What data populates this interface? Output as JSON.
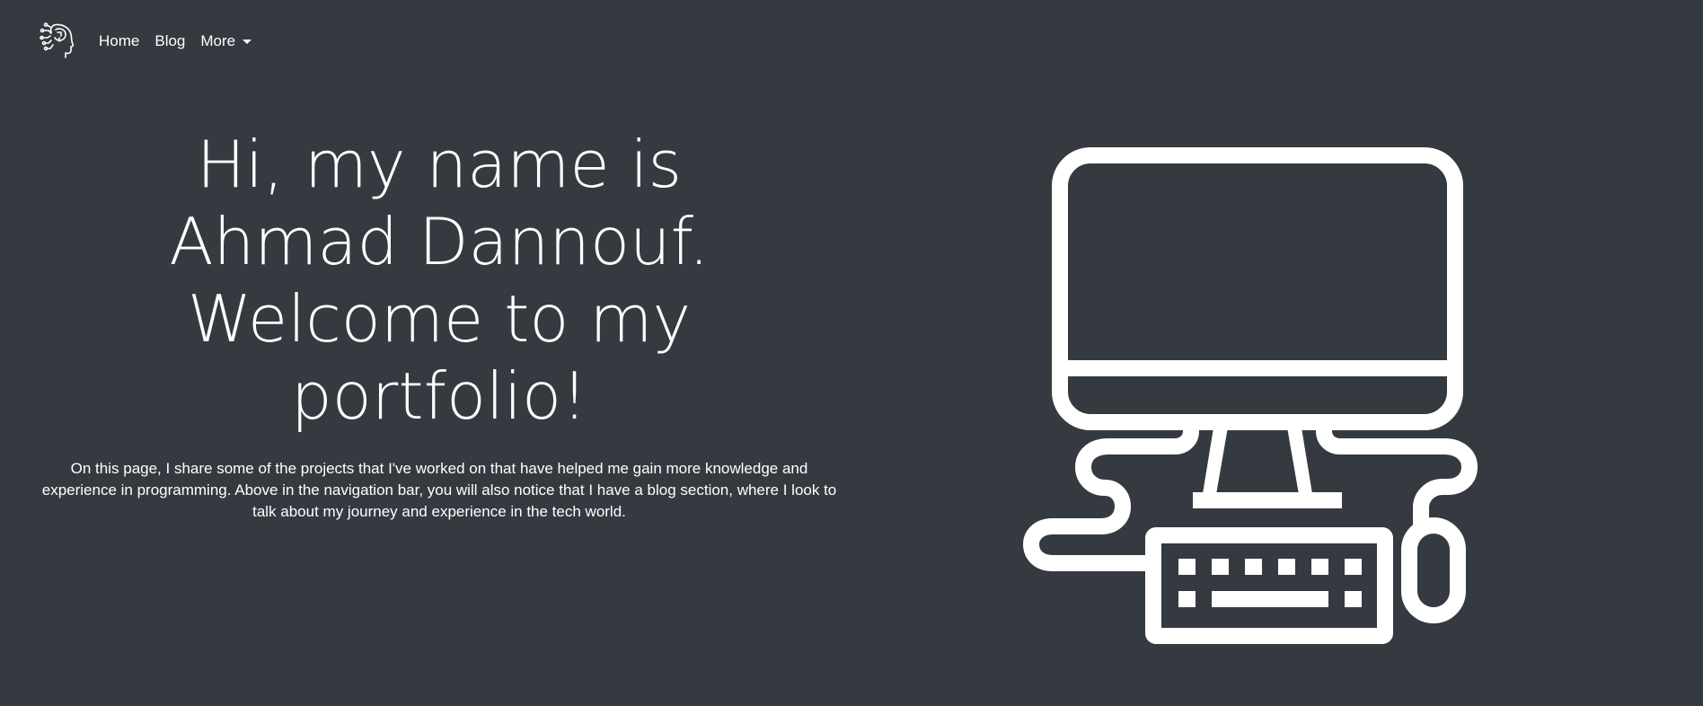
{
  "navbar": {
    "logo_icon": "ai-head-circuit-icon",
    "links": [
      {
        "label": "Home"
      },
      {
        "label": "Blog"
      },
      {
        "label": "More",
        "dropdown": true
      }
    ]
  },
  "hero": {
    "title": "Hi, my name is Ahmad Dannouf. Welcome to my portfolio!",
    "description": "On this page, I share some of the projects that I've worked on that have helped me gain more knowledge and experience in programming. Above in the navigation bar, you will also notice that I have a blog section, where I look to talk about my journey and experience in the tech world.",
    "illustration_icon": "computer-workstation-icon"
  },
  "colors": {
    "background": "#343a40",
    "foreground": "#ffffff"
  }
}
